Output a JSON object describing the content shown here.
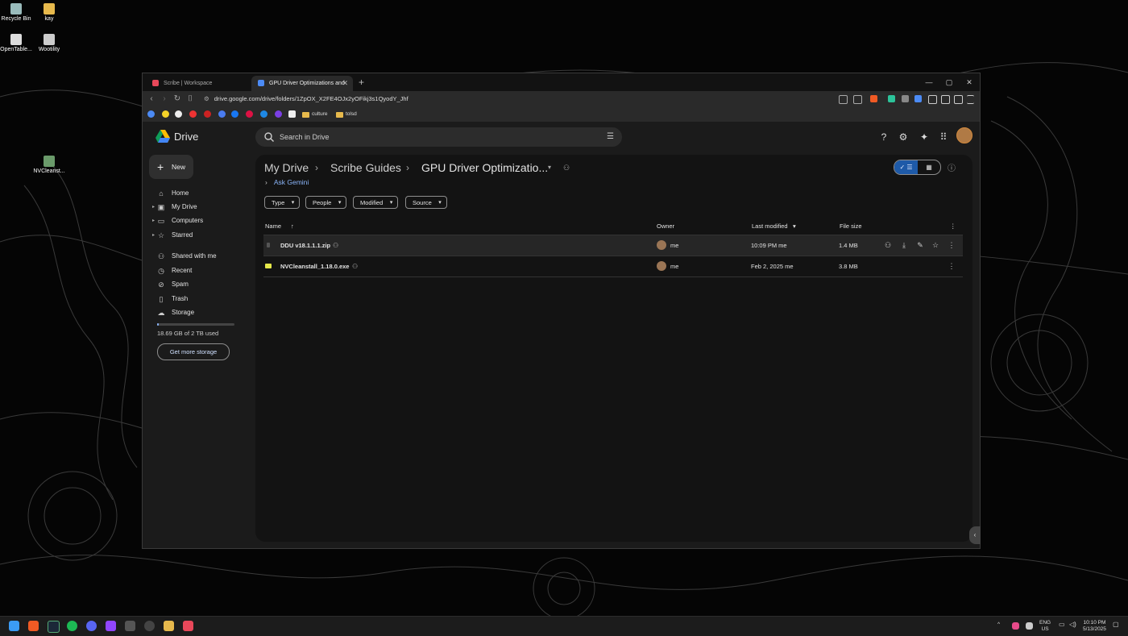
{
  "desktop": {
    "icons": [
      {
        "label": "Recycle Bin"
      },
      {
        "label": "kay"
      },
      {
        "label": "OpenTable..."
      },
      {
        "label": "Wootility"
      },
      {
        "label": "NVCleanst..."
      }
    ]
  },
  "browser": {
    "tabs": [
      {
        "title": "Scribe | Workspace",
        "active": false
      },
      {
        "title": "GPU Driver Optimizations and",
        "active": true
      }
    ],
    "url": "drive.google.com/drive/folders/1ZpOX_X2FE4OJx2yOFikj3s1QyodY_Jhf",
    "bookmark_folders": [
      "culture",
      "tolsd"
    ]
  },
  "drive": {
    "app_name": "Drive",
    "search_placeholder": "Search in Drive",
    "new_label": "New",
    "sidebar": [
      {
        "label": "Home",
        "icon": "home-icon"
      },
      {
        "label": "My Drive",
        "icon": "drive-icon"
      },
      {
        "label": "Computers",
        "icon": "computer-icon"
      },
      {
        "label": "Starred",
        "icon": "star-icon"
      },
      {
        "label": "Shared with me",
        "icon": "people-icon"
      },
      {
        "label": "Recent",
        "icon": "clock-icon"
      },
      {
        "label": "Spam",
        "icon": "spam-icon"
      },
      {
        "label": "Trash",
        "icon": "trash-icon"
      },
      {
        "label": "Storage",
        "icon": "cloud-icon"
      }
    ],
    "storage_text": "18.69 GB of 2 TB used",
    "storage_used_fraction": 0.01,
    "get_more_storage": "Get more storage",
    "breadcrumb": [
      "My Drive",
      "Scribe Guides",
      "GPU Driver Optimizatio..."
    ],
    "ask_gemini": "Ask Gemini",
    "filters": [
      "Type",
      "People",
      "Modified",
      "Source"
    ],
    "columns": {
      "name": "Name",
      "owner": "Owner",
      "last_modified": "Last modified",
      "file_size": "File size"
    },
    "files": [
      {
        "name": "DDU v18.1.1.1.zip",
        "owner": "me",
        "modified": "10:09 PM me",
        "size": "1.4 MB"
      },
      {
        "name": "NVCleanstall_1.18.0.exe",
        "owner": "me",
        "modified": "Feb 2, 2025 me",
        "size": "3.8 MB"
      }
    ]
  },
  "taskbar": {
    "language": "ENG",
    "region": "US",
    "time": "10:10 PM",
    "date": "5/13/2025"
  },
  "colors": {
    "accent": "#8ab4f8",
    "view_toggle": "#1e5aa8"
  }
}
